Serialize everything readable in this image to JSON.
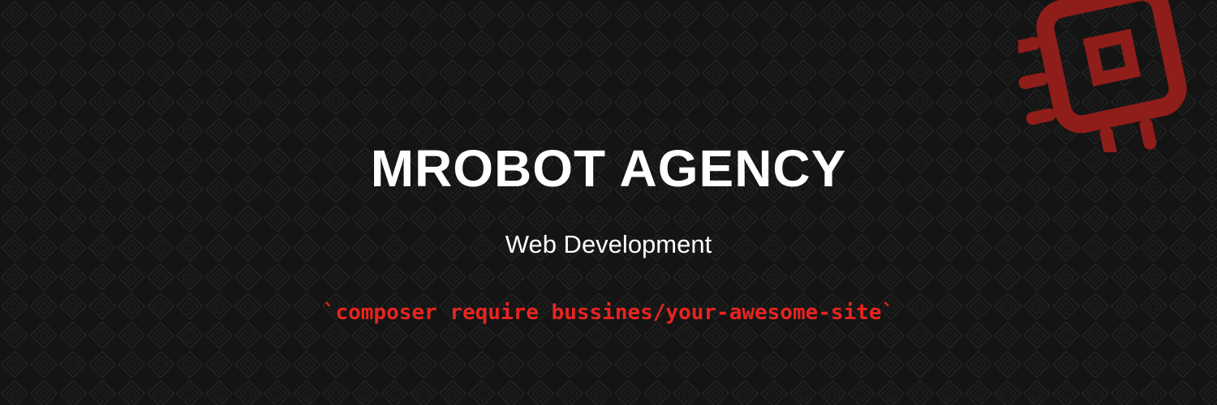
{
  "banner": {
    "title": "MROBOT AGENCY",
    "subtitle": "Web Development",
    "command": "`composer require bussines/your-awesome-site`",
    "logo_icon": "chip-icon"
  },
  "colors": {
    "background": "#141414",
    "pattern_line": "#242424",
    "text": "#ffffff",
    "accent": "#e8241f",
    "logo": "#8f1d1a"
  }
}
